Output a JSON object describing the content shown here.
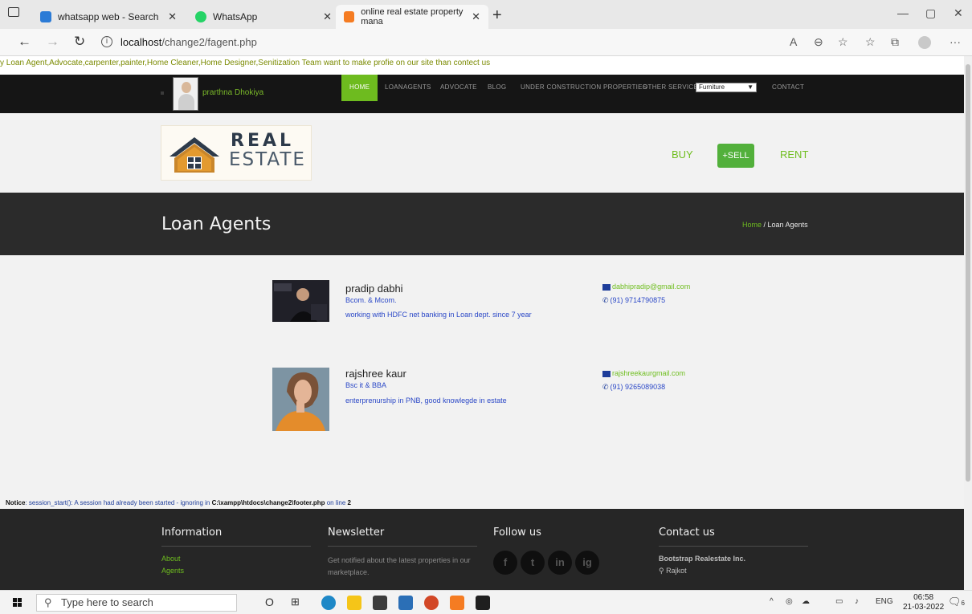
{
  "browser": {
    "tabs": [
      {
        "label": "whatsapp web - Search",
        "icon": "search-icon",
        "color": "#2b7bd6"
      },
      {
        "label": "WhatsApp",
        "icon": "whatsapp-icon",
        "color": "#25d366"
      },
      {
        "label": "online real estate property mana",
        "icon": "xampp-icon",
        "color": "#f57c22"
      }
    ],
    "url_host": "localhost",
    "url_path": "/change2/fagent.php"
  },
  "site": {
    "marquee": "y Loan Agent,Advocate,carpenter,painter,Home Cleaner,Home Designer,Senitization Team want to make profie on our site than contect us",
    "username": "prarthna Dhokiya",
    "nav": {
      "home": "HOME",
      "loanagents": "LOANAGENTS",
      "advocate": "ADVOCATE",
      "blog": "BLOG",
      "under_construction": "UNDER CONSTRUCTION PROPERTIES",
      "other_services": "OTHER SERVICES:",
      "other_services_selected": "Furniture",
      "contact": "CONTACT"
    },
    "logo": {
      "line1": "REAL",
      "line2": "ESTATE"
    },
    "header_links": {
      "buy": "BUY",
      "sell": "+SELL",
      "rent": "RENT"
    },
    "banner": {
      "title": "Loan Agents",
      "crumb_home": "Home",
      "crumb_sep": " / ",
      "crumb_current": "Loan Agents"
    },
    "agents": [
      {
        "name": "pradip dabhi",
        "degree": "Bcom. & Mcom.",
        "description": "working with HDFC net banking in Loan dept. since 7 year",
        "email": "dabhipradip@gmail.com",
        "phone": "(91) 9714790875"
      },
      {
        "name": "rajshree kaur",
        "degree": "Bsc it & BBA",
        "description": "enterprenurship in PNB, good knowlegde in estate",
        "email": "rajshreekaurgmail.com",
        "phone": "(91) 9265089038"
      }
    ],
    "notice": {
      "label": "Notice",
      "text": ": session_start(): A session had already been started - ignoring in ",
      "file": "C:\\xampp\\htdocs\\change2\\footer.php",
      "mid": " on line ",
      "line": "2"
    },
    "footer": {
      "information": {
        "heading": "Information",
        "links": [
          "About",
          "Agents"
        ]
      },
      "newsletter": {
        "heading": "Newsletter",
        "text": "Get notified about the latest properties in our marketplace."
      },
      "follow": {
        "heading": "Follow us",
        "icons": [
          "f",
          "t",
          "in",
          "ig"
        ]
      },
      "contact": {
        "heading": "Contact us",
        "company": "Bootstrap Realestate Inc.",
        "city": "Rajkot"
      }
    }
  },
  "taskbar": {
    "search_placeholder": "Type here to search",
    "language": "ENG",
    "time": "06:58",
    "date": "21-03-2022",
    "notifications": "6"
  },
  "colors": {
    "accent_green": "#6fbe1f",
    "nav_dark": "#151515",
    "link_blue": "#2b48c7"
  }
}
